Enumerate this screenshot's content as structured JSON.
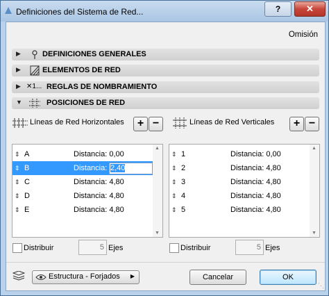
{
  "window": {
    "title": "Definiciones del Sistema de Red...",
    "help_label": "?",
    "close_label": "✕"
  },
  "preset": "Omisión",
  "sections": [
    {
      "label": "DEFINICIONES GENERALES",
      "icon": "pin-icon",
      "expanded": false
    },
    {
      "label": "ELEMENTOS DE RED",
      "icon": "grid-element-icon",
      "expanded": false
    },
    {
      "label": "REGLAS DE NOMBRAMIENTO",
      "icon": "naming-icon",
      "expanded": false,
      "icon_text": "✕1..."
    },
    {
      "label": "POSICIONES DE RED",
      "icon": "grid-position-icon",
      "expanded": true
    }
  ],
  "horizontal": {
    "header": "Líneas de Red Horizontales",
    "add_label": "+",
    "remove_label": "−",
    "rows": [
      {
        "name": "A",
        "distance_label": "Distancia:",
        "distance": "0,00"
      },
      {
        "name": "B",
        "distance_label": "Distancia:",
        "distance": "2,40"
      },
      {
        "name": "C",
        "distance_label": "Distancia:",
        "distance": "4,80"
      },
      {
        "name": "D",
        "distance_label": "Distancia:",
        "distance": "4,80"
      },
      {
        "name": "E",
        "distance_label": "Distancia:",
        "distance": "4,80"
      }
    ],
    "distribute_label": "Distribuir",
    "distribute_count": "5",
    "axes_label": "Ejes"
  },
  "vertical": {
    "header": "Líneas de Red Verticales",
    "add_label": "+",
    "remove_label": "−",
    "rows": [
      {
        "name": "1",
        "distance_label": "Distancia:",
        "distance": "0,00"
      },
      {
        "name": "2",
        "distance_label": "Distancia:",
        "distance": "4,80"
      },
      {
        "name": "3",
        "distance_label": "Distancia:",
        "distance": "4,80"
      },
      {
        "name": "4",
        "distance_label": "Distancia:",
        "distance": "4,80"
      },
      {
        "name": "5",
        "distance_label": "Distancia:",
        "distance": "4,80"
      }
    ],
    "distribute_label": "Distribuir",
    "distribute_count": "5",
    "axes_label": "Ejes"
  },
  "footer": {
    "layer": "Estructura - Forjados",
    "cancel_label": "Cancelar",
    "ok_label": "OK"
  },
  "colors": {
    "selection": "#3399ff",
    "ok_border": "#3c7fb1"
  }
}
